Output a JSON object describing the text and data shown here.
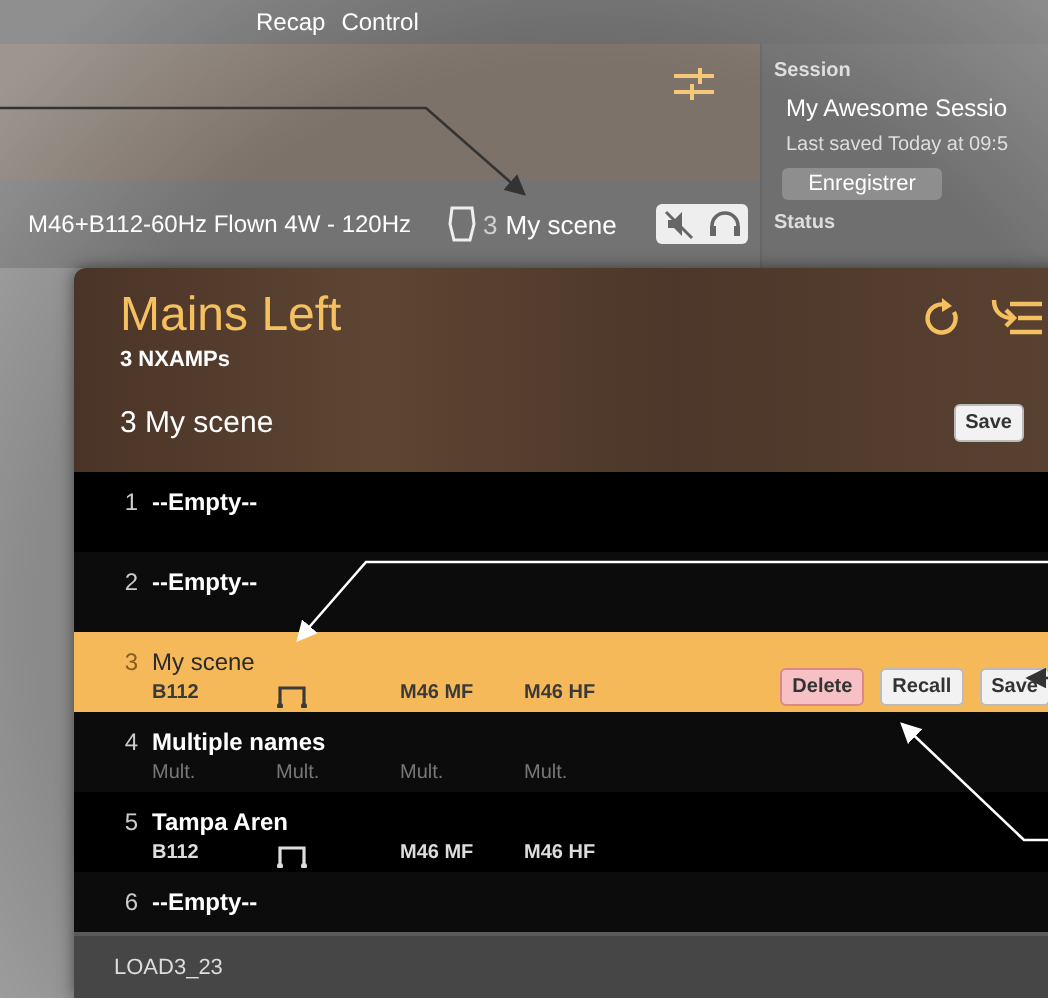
{
  "background_app": {
    "menu": [
      "Recap",
      "Control"
    ],
    "preset": "M46+B112-60Hz Flown 4W - 120Hz",
    "scene_number": "3",
    "scene_name": "My scene",
    "session": {
      "heading": "Session",
      "name": "My Awesome Sessio",
      "saved": "Last saved Today at 09:5",
      "save_button": "Enregistrer"
    },
    "status_heading": "Status"
  },
  "panel": {
    "title": "Mains Left",
    "subtitle": "3 NXAMPs",
    "current_scene": "3 My scene",
    "save_button": "Save"
  },
  "scenes": [
    {
      "number": "1",
      "name": "--Empty--",
      "kind": "empty",
      "selected": false
    },
    {
      "number": "2",
      "name": "--Empty--",
      "kind": "empty",
      "selected": false
    },
    {
      "number": "3",
      "name": "My scene",
      "kind": "single",
      "selected": true,
      "details": [
        "B112",
        "M46 MF",
        "M46 HF"
      ],
      "actions": [
        {
          "label": "Delete",
          "kind": "danger"
        },
        {
          "label": "Recall",
          "kind": "normal"
        },
        {
          "label": "Save",
          "kind": "normal"
        }
      ]
    },
    {
      "number": "4",
      "name": "Multiple names",
      "kind": "multiple",
      "selected": false,
      "details": [
        "Mult.",
        "Mult.",
        "Mult.",
        "Mult."
      ]
    },
    {
      "number": "5",
      "name": "Tampa Aren",
      "kind": "single",
      "selected": false,
      "details": [
        "B112",
        "M46 MF",
        "M46 HF"
      ]
    },
    {
      "number": "6",
      "name": "--Empty--",
      "kind": "empty",
      "selected": false
    }
  ],
  "footer": "LOAD3_23"
}
